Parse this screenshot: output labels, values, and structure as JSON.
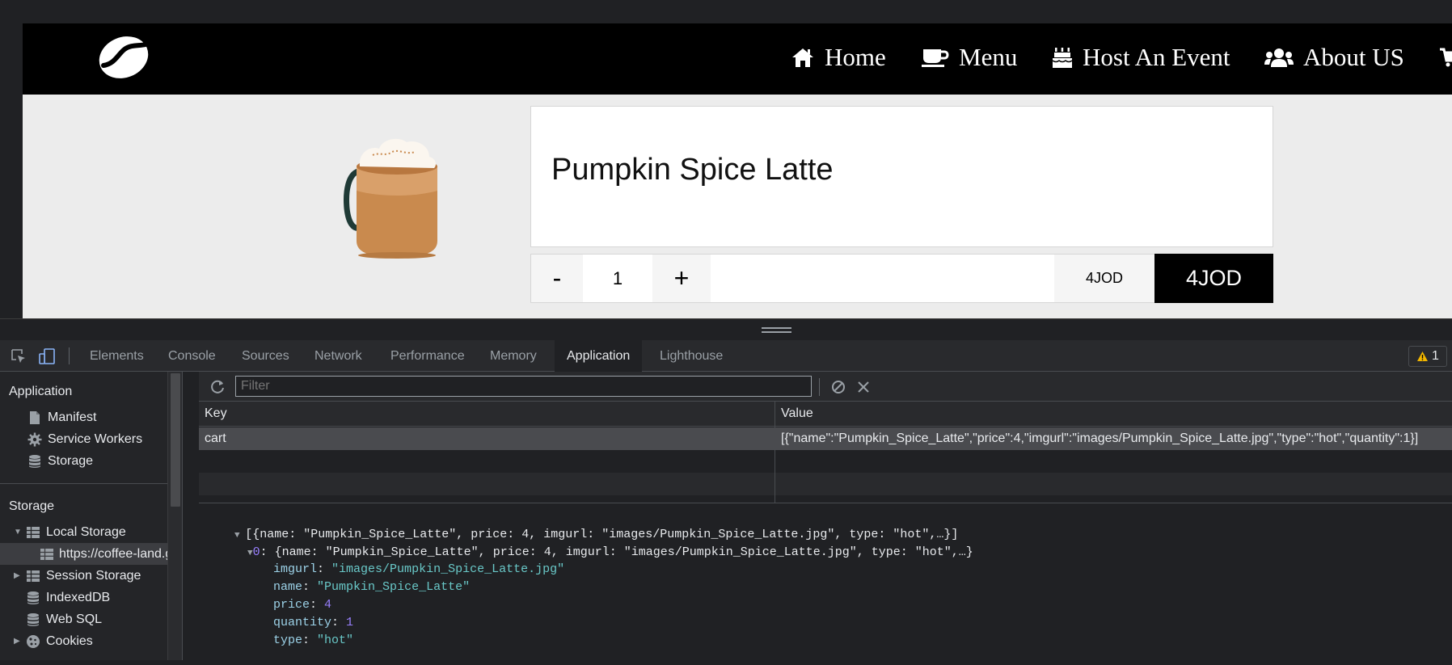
{
  "site": {
    "nav": [
      {
        "label": "Home",
        "icon": "home-icon"
      },
      {
        "label": "Menu",
        "icon": "coffee-cup-icon"
      },
      {
        "label": "Host An Event",
        "icon": "birthday-cake-icon"
      },
      {
        "label": "About US",
        "icon": "users-icon"
      }
    ],
    "cart_icon": "cart-icon",
    "logo_icon": "coffee-bean-logo-icon",
    "product": {
      "title": "Pumpkin Spice Latte",
      "quantity": "1",
      "minus_label": "-",
      "plus_label": "+",
      "unit_price": "4JOD",
      "total_price": "4JOD"
    }
  },
  "devtools": {
    "tabs": [
      "Elements",
      "Console",
      "Sources",
      "Network",
      "Performance",
      "Memory",
      "Application",
      "Lighthouse"
    ],
    "active_tab": "Application",
    "warning_count": "1",
    "sidebar": {
      "application_heading": "Application",
      "application_items": [
        "Manifest",
        "Service Workers",
        "Storage"
      ],
      "storage_heading": "Storage",
      "storage_items": [
        "Local Storage",
        "https://coffee-land.g",
        "Session Storage",
        "IndexedDB",
        "Web SQL",
        "Cookies"
      ]
    },
    "filter_placeholder": "Filter",
    "table": {
      "columns": [
        "Key",
        "Value"
      ],
      "rows": [
        {
          "key": "cart",
          "value": "[{\"name\":\"Pumpkin_Spice_Latte\",\"price\":4,\"imgurl\":\"images/Pumpkin_Spice_Latte.jpg\",\"type\":\"hot\",\"quantity\":1}]"
        }
      ]
    },
    "preview": {
      "root": "[{name: \"Pumpkin_Spice_Latte\", price: 4, imgurl: \"images/Pumpkin_Spice_Latte.jpg\", type: \"hot\",…}]",
      "item_index": "0",
      "item_summary": ": {name: \"Pumpkin_Spice_Latte\", price: 4, imgurl: \"images/Pumpkin_Spice_Latte.jpg\", type: \"hot\",…}",
      "props": [
        {
          "key": "imgurl",
          "value": "\"images/Pumpkin_Spice_Latte.jpg\"",
          "kind": "str"
        },
        {
          "key": "name",
          "value": "\"Pumpkin_Spice_Latte\"",
          "kind": "str"
        },
        {
          "key": "price",
          "value": "4",
          "kind": "num"
        },
        {
          "key": "quantity",
          "value": "1",
          "kind": "num"
        },
        {
          "key": "type",
          "value": "\"hot\"",
          "kind": "str"
        }
      ]
    }
  }
}
